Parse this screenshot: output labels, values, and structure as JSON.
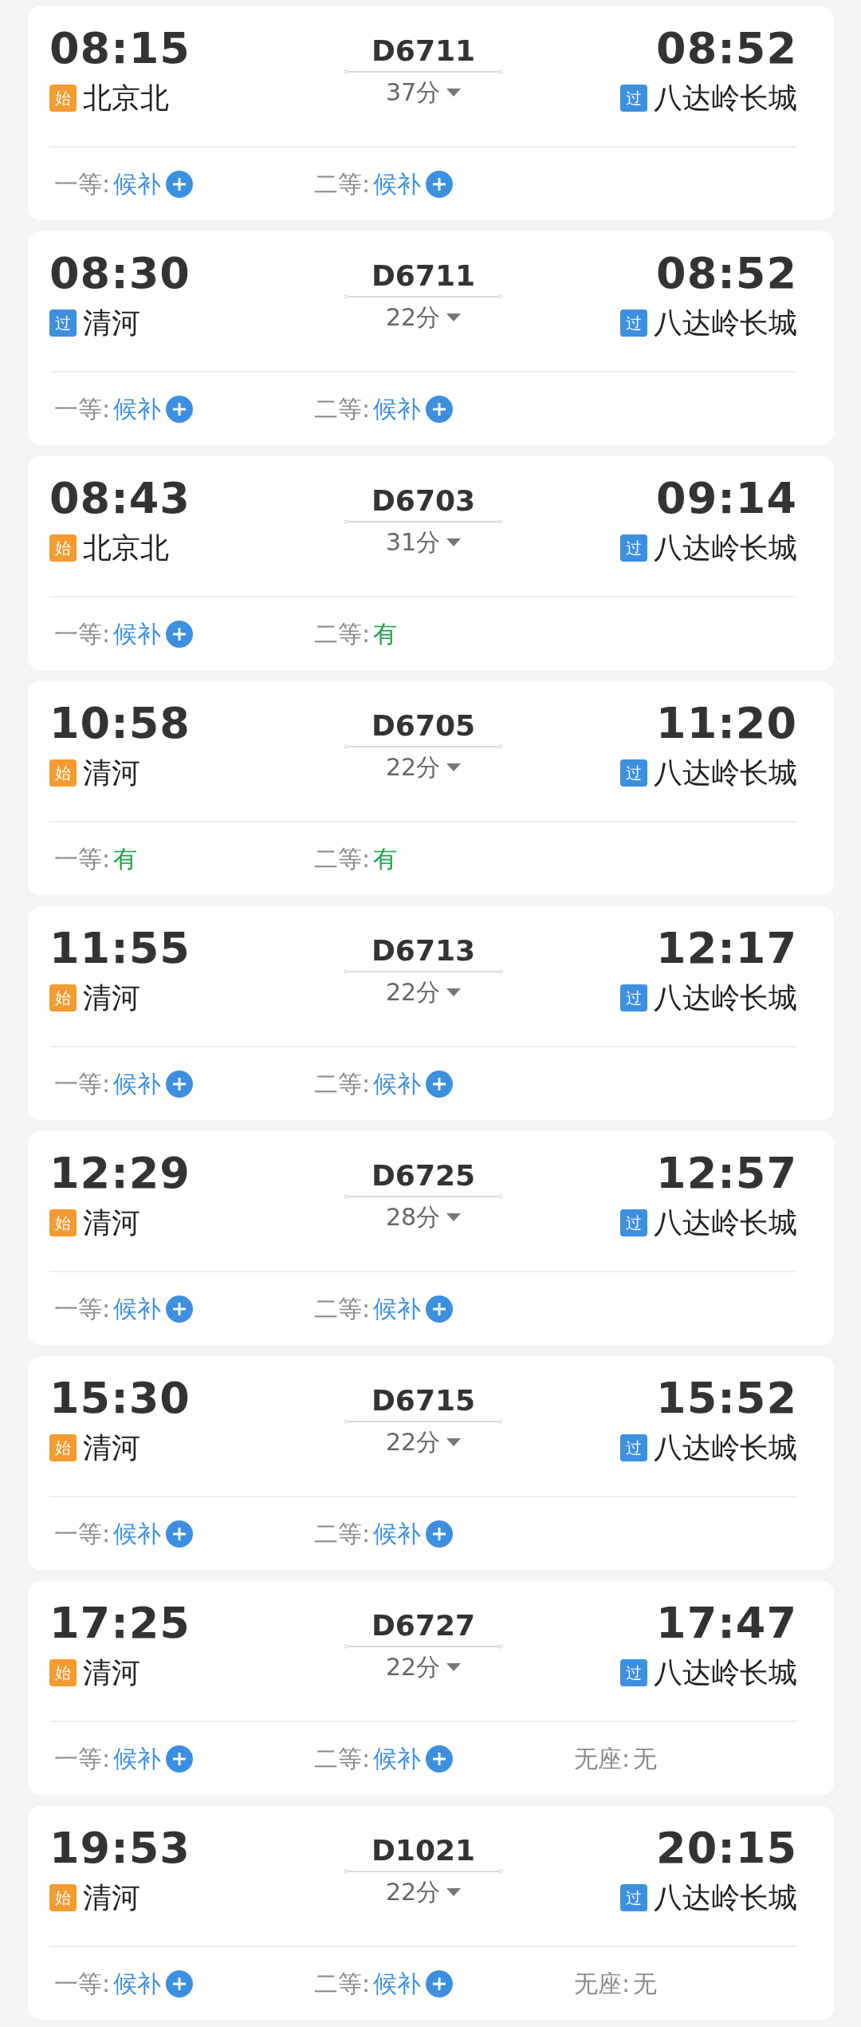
{
  "trains": [
    {
      "depart": "08:15",
      "from": {
        "badge": "始",
        "kind": "origin",
        "name": "北京北"
      },
      "number": "D6711",
      "duration": "37分",
      "arrive": "08:52",
      "to": {
        "badge": "过",
        "kind": "pass",
        "name": "八达岭长城"
      },
      "seats": [
        {
          "label": "一等:",
          "value": "候补",
          "kind": "waitlist"
        },
        {
          "label": "二等:",
          "value": "候补",
          "kind": "waitlist"
        }
      ]
    },
    {
      "depart": "08:30",
      "from": {
        "badge": "过",
        "kind": "pass",
        "name": "清河"
      },
      "number": "D6711",
      "duration": "22分",
      "arrive": "08:52",
      "to": {
        "badge": "过",
        "kind": "pass",
        "name": "八达岭长城"
      },
      "seats": [
        {
          "label": "一等:",
          "value": "候补",
          "kind": "waitlist"
        },
        {
          "label": "二等:",
          "value": "候补",
          "kind": "waitlist"
        }
      ]
    },
    {
      "depart": "08:43",
      "from": {
        "badge": "始",
        "kind": "origin",
        "name": "北京北"
      },
      "number": "D6703",
      "duration": "31分",
      "arrive": "09:14",
      "to": {
        "badge": "过",
        "kind": "pass",
        "name": "八达岭长城"
      },
      "seats": [
        {
          "label": "一等:",
          "value": "候补",
          "kind": "waitlist"
        },
        {
          "label": "二等:",
          "value": "有",
          "kind": "available"
        }
      ]
    },
    {
      "depart": "10:58",
      "from": {
        "badge": "始",
        "kind": "origin",
        "name": "清河"
      },
      "number": "D6705",
      "duration": "22分",
      "arrive": "11:20",
      "to": {
        "badge": "过",
        "kind": "pass",
        "name": "八达岭长城"
      },
      "seats": [
        {
          "label": "一等:",
          "value": "有",
          "kind": "available"
        },
        {
          "label": "二等:",
          "value": "有",
          "kind": "available"
        }
      ]
    },
    {
      "depart": "11:55",
      "from": {
        "badge": "始",
        "kind": "origin",
        "name": "清河"
      },
      "number": "D6713",
      "duration": "22分",
      "arrive": "12:17",
      "to": {
        "badge": "过",
        "kind": "pass",
        "name": "八达岭长城"
      },
      "seats": [
        {
          "label": "一等:",
          "value": "候补",
          "kind": "waitlist"
        },
        {
          "label": "二等:",
          "value": "候补",
          "kind": "waitlist"
        }
      ]
    },
    {
      "depart": "12:29",
      "from": {
        "badge": "始",
        "kind": "origin",
        "name": "清河"
      },
      "number": "D6725",
      "duration": "28分",
      "arrive": "12:57",
      "to": {
        "badge": "过",
        "kind": "pass",
        "name": "八达岭长城"
      },
      "seats": [
        {
          "label": "一等:",
          "value": "候补",
          "kind": "waitlist"
        },
        {
          "label": "二等:",
          "value": "候补",
          "kind": "waitlist"
        }
      ]
    },
    {
      "depart": "15:30",
      "from": {
        "badge": "始",
        "kind": "origin",
        "name": "清河"
      },
      "number": "D6715",
      "duration": "22分",
      "arrive": "15:52",
      "to": {
        "badge": "过",
        "kind": "pass",
        "name": "八达岭长城"
      },
      "seats": [
        {
          "label": "一等:",
          "value": "候补",
          "kind": "waitlist"
        },
        {
          "label": "二等:",
          "value": "候补",
          "kind": "waitlist"
        }
      ]
    },
    {
      "depart": "17:25",
      "from": {
        "badge": "始",
        "kind": "origin",
        "name": "清河"
      },
      "number": "D6727",
      "duration": "22分",
      "arrive": "17:47",
      "to": {
        "badge": "过",
        "kind": "pass",
        "name": "八达岭长城"
      },
      "seats": [
        {
          "label": "一等:",
          "value": "候补",
          "kind": "waitlist"
        },
        {
          "label": "二等:",
          "value": "候补",
          "kind": "waitlist"
        },
        {
          "label": "无座:",
          "value": "无",
          "kind": "none"
        }
      ]
    },
    {
      "depart": "19:53",
      "from": {
        "badge": "始",
        "kind": "origin",
        "name": "清河"
      },
      "number": "D1021",
      "duration": "22分",
      "arrive": "20:15",
      "to": {
        "badge": "过",
        "kind": "pass",
        "name": "八达岭长城"
      },
      "seats": [
        {
          "label": "一等:",
          "value": "候补",
          "kind": "waitlist"
        },
        {
          "label": "二等:",
          "value": "候补",
          "kind": "waitlist"
        },
        {
          "label": "无座:",
          "value": "无",
          "kind": "none"
        }
      ]
    }
  ]
}
